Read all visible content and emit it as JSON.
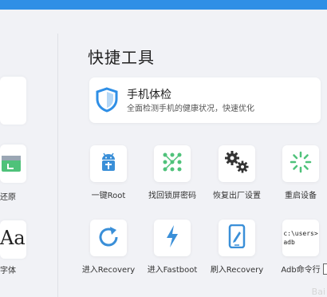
{
  "top_tabs": [
    "",
    ""
  ],
  "left_labels": [
    "",
    "还原",
    "字体"
  ],
  "left_icons": [
    "calendar-icon",
    "font-aa-icon"
  ],
  "left_glyph": "Aa",
  "section_title": "快捷工具",
  "checkup": {
    "title": "手机体检",
    "desc": "全面检测手机的健康状况，快速优化",
    "icon": "shield-icon"
  },
  "tools": [
    {
      "label": "一键Root",
      "icon": "android-root-icon"
    },
    {
      "label": "找回锁屏密码",
      "icon": "pattern-lock-icon"
    },
    {
      "label": "恢复出厂设置",
      "icon": "gears-icon"
    },
    {
      "label": "重启设备",
      "icon": "restart-spinner-icon"
    },
    {
      "label": "进入Recovery",
      "icon": "refresh-arrow-icon"
    },
    {
      "label": "进入Fastboot",
      "icon": "lightning-icon"
    },
    {
      "label": "刷入Recovery",
      "icon": "phone-edit-icon"
    },
    {
      "label": "Adb命令行",
      "icon": "terminal-icon",
      "line1": "c:\\users>",
      "line2": "adb"
    }
  ],
  "colors": {
    "accent": "#2f8fe6",
    "green": "#4fc27a",
    "android_blue": "#3a8fd8",
    "gear": "#333333"
  },
  "watermark": "Bai"
}
